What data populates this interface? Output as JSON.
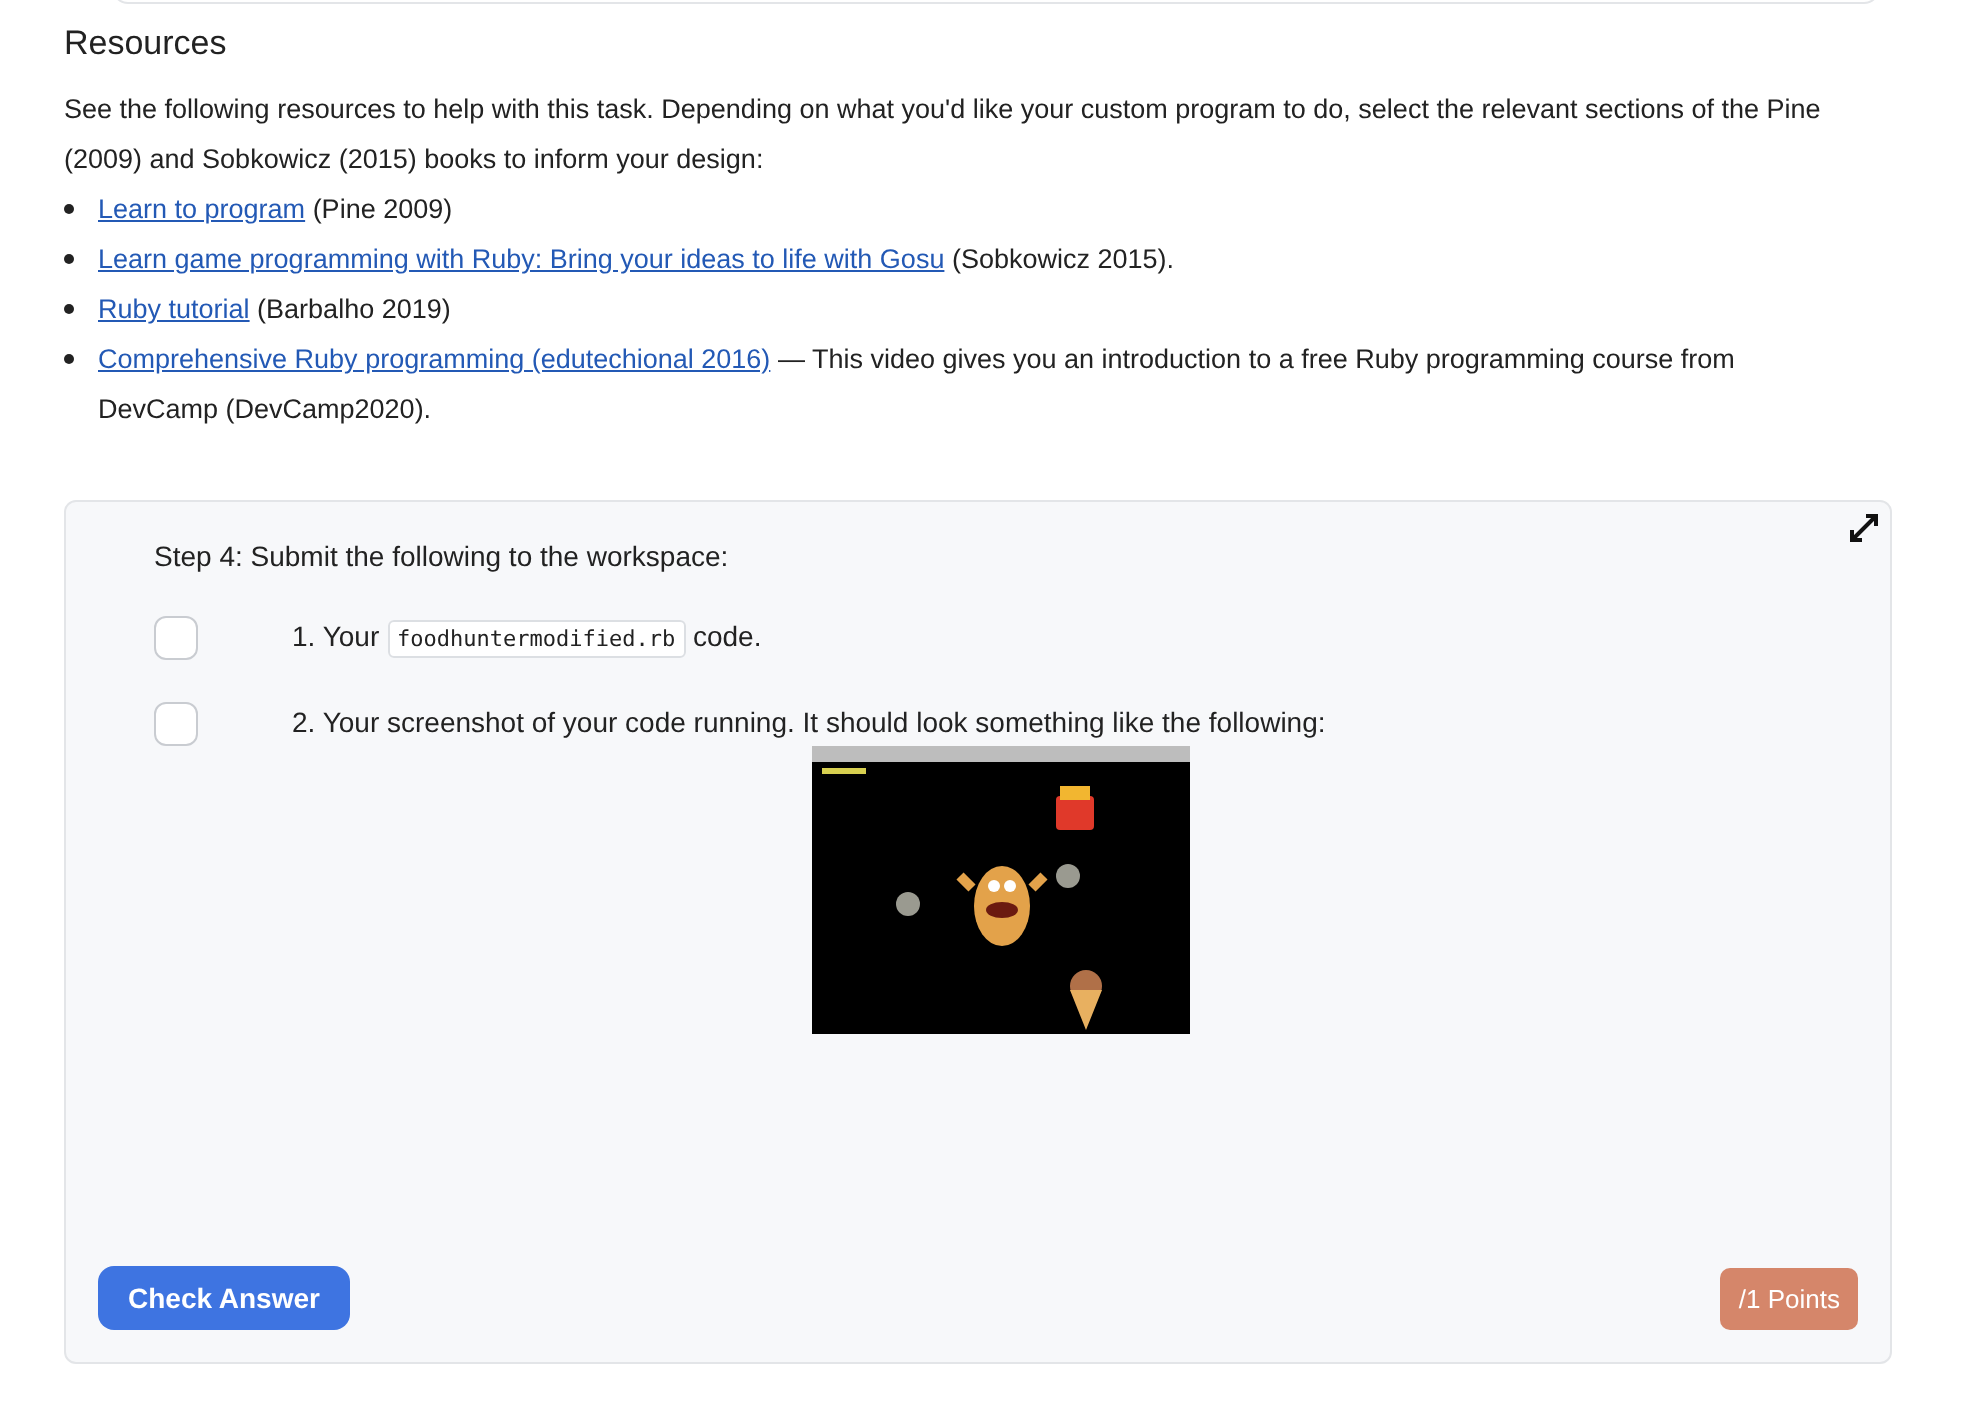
{
  "resources": {
    "heading": "Resources",
    "intro": "See the following resources to help with this task. Depending on what you'd like your custom program to do, select the relevant sections of the Pine (2009) and Sobkowicz (2015) books to inform your design:",
    "items": [
      {
        "link": "Learn to program",
        "text": "(Pine 2009)"
      },
      {
        "link": "Learn game programming with Ruby: Bring your ideas to life with Gosu",
        "text": "(Sobkowicz 2015)."
      },
      {
        "link": "Ruby tutorial",
        "text": "(Barbalho 2019)"
      },
      {
        "link": "Comprehensive Ruby programming (edutechional 2016)",
        "text": "— This video gives you an introduction to a free Ruby programming course from DevCamp (DevCamp2020)."
      }
    ]
  },
  "task": {
    "title": "Step 4: Submit the following to the workspace:",
    "steps": [
      {
        "kind": "code",
        "checked": false,
        "before": "1. Your",
        "code": "foodhuntermodified.rb",
        "after": "code."
      },
      {
        "kind": "image",
        "checked": false,
        "before": "2. Your screenshot of your code running. It should look something like the following:"
      }
    ],
    "button": "Check Answer",
    "points": "/1 Points"
  }
}
